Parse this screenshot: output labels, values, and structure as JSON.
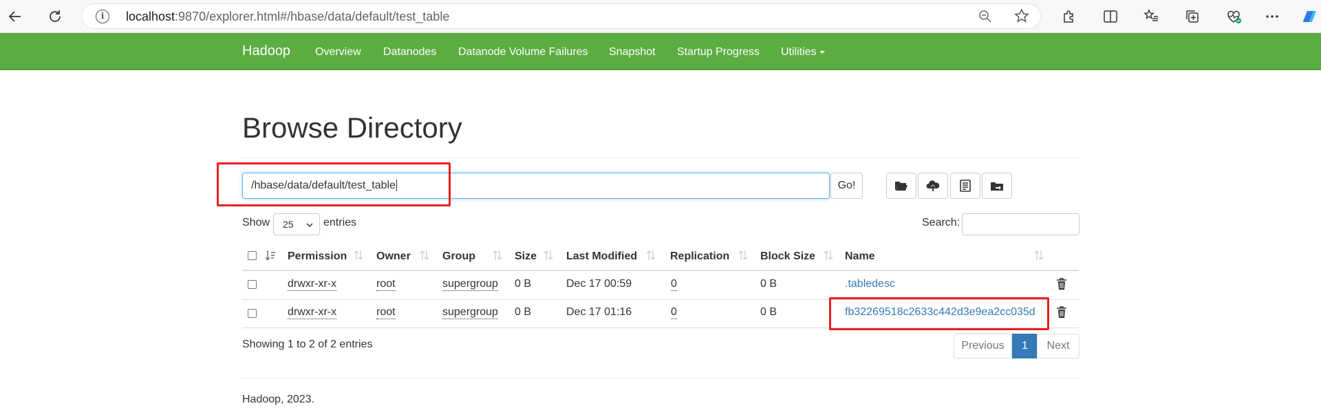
{
  "browser": {
    "url_host": "localhost",
    "url_rest": ":9870/explorer.html#/hbase/data/default/test_table"
  },
  "navbar": {
    "brand": "Hadoop",
    "items": [
      "Overview",
      "Datanodes",
      "Datanode Volume Failures",
      "Snapshot",
      "Startup Progress",
      "Utilities"
    ]
  },
  "page": {
    "title": "Browse Directory",
    "path_value": "/hbase/data/default/test_table",
    "go_label": "Go!",
    "show_label": "Show",
    "entries_value": "25",
    "entries_label": "entries",
    "search_label": "Search:"
  },
  "table": {
    "headers": [
      "Permission",
      "Owner",
      "Group",
      "Size",
      "Last Modified",
      "Replication",
      "Block Size",
      "Name"
    ],
    "rows": [
      {
        "permission": "drwxr-xr-x",
        "owner": "root",
        "group": "supergroup",
        "size": "0 B",
        "modified": "Dec 17 00:59",
        "replication": "0",
        "block_size": "0 B",
        "name": ".tabledesc"
      },
      {
        "permission": "drwxr-xr-x",
        "owner": "root",
        "group": "supergroup",
        "size": "0 B",
        "modified": "Dec 17 01:16",
        "replication": "0",
        "block_size": "0 B",
        "name": "fb32269518c2633c442d3e9ea2cc035d"
      }
    ]
  },
  "footer_info": {
    "showing": "Showing 1 to 2 of 2 entries",
    "previous": "Previous",
    "current_page": "1",
    "next": "Next",
    "copyright": "Hadoop, 2023."
  },
  "colors": {
    "navbar": "#5cad41",
    "link": "#337ab7",
    "annotation": "#e8201e"
  }
}
